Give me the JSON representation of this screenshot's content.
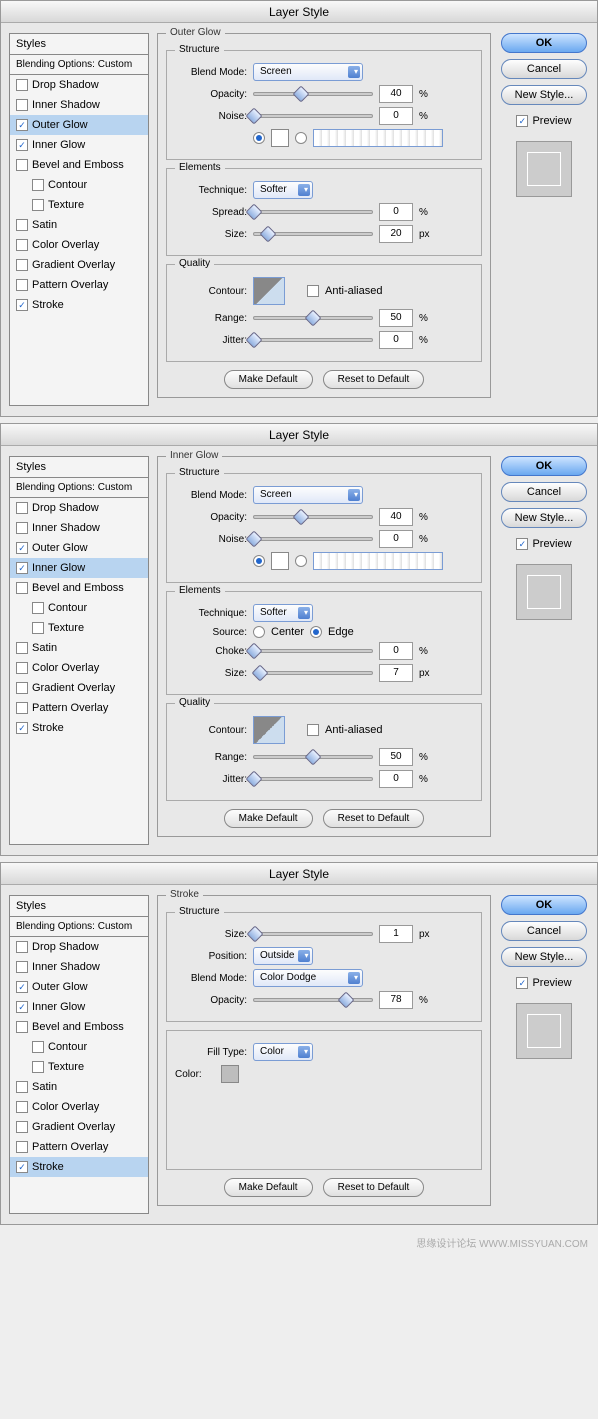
{
  "dialogs": [
    {
      "title": "Layer Style",
      "stylesHeader": "Styles",
      "blendingOptions": "Blending Options: Custom",
      "styleItems": [
        {
          "label": "Drop Shadow",
          "checked": false,
          "selected": false,
          "indent": false
        },
        {
          "label": "Inner Shadow",
          "checked": false,
          "selected": false,
          "indent": false
        },
        {
          "label": "Outer Glow",
          "checked": true,
          "selected": true,
          "indent": false
        },
        {
          "label": "Inner Glow",
          "checked": true,
          "selected": false,
          "indent": false
        },
        {
          "label": "Bevel and Emboss",
          "checked": false,
          "selected": false,
          "indent": false
        },
        {
          "label": "Contour",
          "checked": false,
          "selected": false,
          "indent": true
        },
        {
          "label": "Texture",
          "checked": false,
          "selected": false,
          "indent": true
        },
        {
          "label": "Satin",
          "checked": false,
          "selected": false,
          "indent": false
        },
        {
          "label": "Color Overlay",
          "checked": false,
          "selected": false,
          "indent": false
        },
        {
          "label": "Gradient Overlay",
          "checked": false,
          "selected": false,
          "indent": false
        },
        {
          "label": "Pattern Overlay",
          "checked": false,
          "selected": false,
          "indent": false
        },
        {
          "label": "Stroke",
          "checked": true,
          "selected": false,
          "indent": false
        }
      ],
      "effectTitle": "Outer Glow",
      "groups": {
        "structure": {
          "legend": "Structure",
          "blendModeLabel": "Blend Mode:",
          "blendMode": "Screen",
          "opacityLabel": "Opacity:",
          "opacity": "40",
          "opacityUnit": "%",
          "noiseLabel": "Noise:",
          "noise": "0",
          "noiseUnit": "%"
        },
        "elements": {
          "legend": "Elements",
          "techniqueLabel": "Technique:",
          "technique": "Softer",
          "spreadLabel": "Spread:",
          "spread": "0",
          "spreadUnit": "%",
          "sizeLabel": "Size:",
          "size": "20",
          "sizeUnit": "px"
        },
        "quality": {
          "legend": "Quality",
          "contourLabel": "Contour:",
          "antiAliased": "Anti-aliased",
          "rangeLabel": "Range:",
          "range": "50",
          "rangeUnit": "%",
          "jitterLabel": "Jitter:",
          "jitter": "0",
          "jitterUnit": "%"
        }
      },
      "makeDefault": "Make Default",
      "resetDefault": "Reset to Default",
      "ok": "OK",
      "cancel": "Cancel",
      "newStyle": "New Style...",
      "preview": "Preview"
    },
    {
      "title": "Layer Style",
      "stylesHeader": "Styles",
      "blendingOptions": "Blending Options: Custom",
      "styleItems": [
        {
          "label": "Drop Shadow",
          "checked": false,
          "selected": false,
          "indent": false
        },
        {
          "label": "Inner Shadow",
          "checked": false,
          "selected": false,
          "indent": false
        },
        {
          "label": "Outer Glow",
          "checked": true,
          "selected": false,
          "indent": false
        },
        {
          "label": "Inner Glow",
          "checked": true,
          "selected": true,
          "indent": false
        },
        {
          "label": "Bevel and Emboss",
          "checked": false,
          "selected": false,
          "indent": false
        },
        {
          "label": "Contour",
          "checked": false,
          "selected": false,
          "indent": true
        },
        {
          "label": "Texture",
          "checked": false,
          "selected": false,
          "indent": true
        },
        {
          "label": "Satin",
          "checked": false,
          "selected": false,
          "indent": false
        },
        {
          "label": "Color Overlay",
          "checked": false,
          "selected": false,
          "indent": false
        },
        {
          "label": "Gradient Overlay",
          "checked": false,
          "selected": false,
          "indent": false
        },
        {
          "label": "Pattern Overlay",
          "checked": false,
          "selected": false,
          "indent": false
        },
        {
          "label": "Stroke",
          "checked": true,
          "selected": false,
          "indent": false
        }
      ],
      "effectTitle": "Inner Glow",
      "groups": {
        "structure": {
          "legend": "Structure",
          "blendModeLabel": "Blend Mode:",
          "blendMode": "Screen",
          "opacityLabel": "Opacity:",
          "opacity": "40",
          "opacityUnit": "%",
          "noiseLabel": "Noise:",
          "noise": "0",
          "noiseUnit": "%"
        },
        "elements": {
          "legend": "Elements",
          "techniqueLabel": "Technique:",
          "technique": "Softer",
          "sourceLabel": "Source:",
          "sourceCenter": "Center",
          "sourceEdge": "Edge",
          "chokeLabel": "Choke:",
          "choke": "0",
          "chokeUnit": "%",
          "sizeLabel": "Size:",
          "size": "7",
          "sizeUnit": "px"
        },
        "quality": {
          "legend": "Quality",
          "contourLabel": "Contour:",
          "antiAliased": "Anti-aliased",
          "rangeLabel": "Range:",
          "range": "50",
          "rangeUnit": "%",
          "jitterLabel": "Jitter:",
          "jitter": "0",
          "jitterUnit": "%"
        }
      },
      "makeDefault": "Make Default",
      "resetDefault": "Reset to Default",
      "ok": "OK",
      "cancel": "Cancel",
      "newStyle": "New Style...",
      "preview": "Preview"
    },
    {
      "title": "Layer Style",
      "stylesHeader": "Styles",
      "blendingOptions": "Blending Options: Custom",
      "styleItems": [
        {
          "label": "Drop Shadow",
          "checked": false,
          "selected": false,
          "indent": false
        },
        {
          "label": "Inner Shadow",
          "checked": false,
          "selected": false,
          "indent": false
        },
        {
          "label": "Outer Glow",
          "checked": true,
          "selected": false,
          "indent": false
        },
        {
          "label": "Inner Glow",
          "checked": true,
          "selected": false,
          "indent": false
        },
        {
          "label": "Bevel and Emboss",
          "checked": false,
          "selected": false,
          "indent": false
        },
        {
          "label": "Contour",
          "checked": false,
          "selected": false,
          "indent": true
        },
        {
          "label": "Texture",
          "checked": false,
          "selected": false,
          "indent": true
        },
        {
          "label": "Satin",
          "checked": false,
          "selected": false,
          "indent": false
        },
        {
          "label": "Color Overlay",
          "checked": false,
          "selected": false,
          "indent": false
        },
        {
          "label": "Gradient Overlay",
          "checked": false,
          "selected": false,
          "indent": false
        },
        {
          "label": "Pattern Overlay",
          "checked": false,
          "selected": false,
          "indent": false
        },
        {
          "label": "Stroke",
          "checked": true,
          "selected": true,
          "indent": false
        }
      ],
      "effectTitle": "Stroke",
      "groups": {
        "structure": {
          "legend": "Structure",
          "sizeLabel": "Size:",
          "size": "1",
          "sizeUnit": "px",
          "positionLabel": "Position:",
          "position": "Outside",
          "blendModeLabel": "Blend Mode:",
          "blendMode": "Color Dodge",
          "opacityLabel": "Opacity:",
          "opacity": "78",
          "opacityUnit": "%"
        },
        "fill": {
          "legend": "",
          "fillTypeLabel": "Fill Type:",
          "fillType": "Color",
          "colorLabel": "Color:",
          "color": "#bdbdbd"
        }
      },
      "makeDefault": "Make Default",
      "resetDefault": "Reset to Default",
      "ok": "OK",
      "cancel": "Cancel",
      "newStyle": "New Style...",
      "preview": "Preview"
    }
  ],
  "watermark": "思缘设计论坛    WWW.MISSYUAN.COM"
}
